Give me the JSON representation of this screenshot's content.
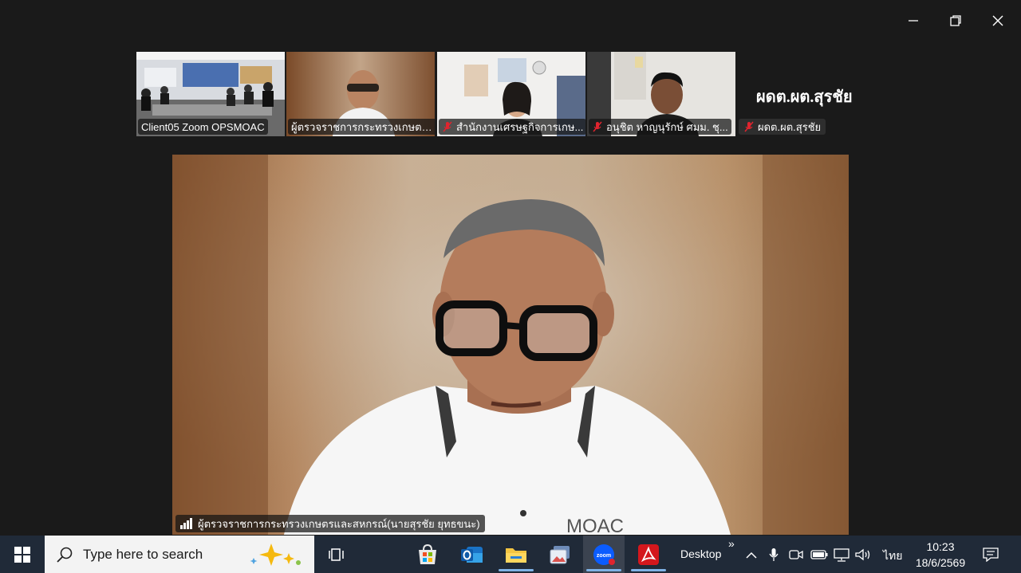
{
  "window": {
    "controls": [
      "minimize-icon",
      "restore-icon",
      "close-icon"
    ]
  },
  "participants": [
    {
      "name": "Client05 Zoom OPSMOAC",
      "muted": false,
      "active": false
    },
    {
      "name": "ผู้ตรวจราชการกระทรวงเกษตร...",
      "muted": false,
      "active": true
    },
    {
      "name": "สำนักงานเศรษฐกิจการเกษ...",
      "muted": true,
      "active": false
    },
    {
      "name": "อนุชิต  หาญนุรักษ์ ศมม. ชุ...",
      "muted": true,
      "active": false
    },
    {
      "name": "ผดต.ผต.สุรชัย",
      "display_name": "ผดต.ผต.สุรชัย",
      "muted": true,
      "active": false
    }
  ],
  "speaker": {
    "name": "ผู้ตรวจราชการกระทรวงเกษตรและสหกรณ์(นายสุรชัย ยุทธขนะ)",
    "shirt_logo": "MOAC"
  },
  "taskbar": {
    "search_placeholder": "Type here to search",
    "desktop_label": "Desktop",
    "language": "ไทย",
    "time": "10:23",
    "date": "18/6/2569",
    "pinned": [
      "task-view-icon",
      "microsoft-store-icon",
      "outlook-icon",
      "file-explorer-icon",
      "photos-icon",
      "zoom-icon",
      "acrobat-icon"
    ],
    "tray": [
      "chevron-up-icon",
      "microphone-icon",
      "camera-icon",
      "battery-icon",
      "network-icon",
      "speaker-icon",
      "notification-icon"
    ],
    "colors": {
      "taskbar_bg": "#202a38",
      "zoom_blue": "#0b5cff",
      "acrobat_red": "#d4171d",
      "active_border": "#2cc86a"
    }
  }
}
